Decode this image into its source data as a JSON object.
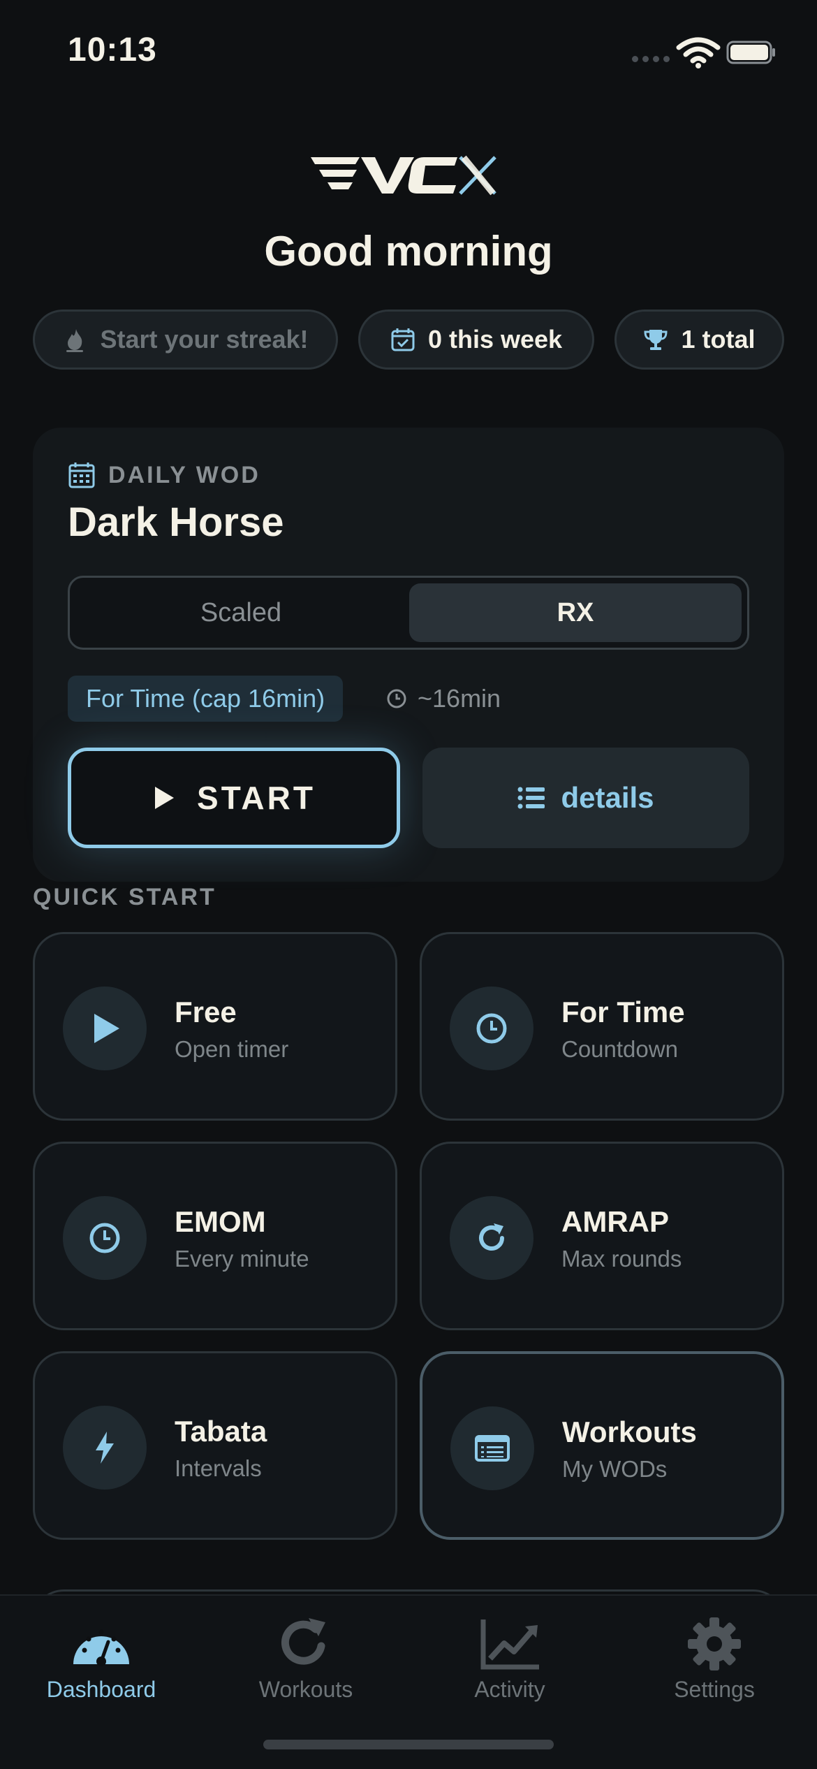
{
  "status_bar": {
    "time": "10:13"
  },
  "header": {
    "greeting": "Good morning"
  },
  "chips": {
    "streak": "Start your streak!",
    "week": "0 this week",
    "total": "1 total"
  },
  "daily_wod": {
    "label": "DAILY WOD",
    "title": "Dark Horse",
    "segment": {
      "options": [
        "Scaled",
        "RX"
      ],
      "selected": "RX"
    },
    "format": "For Time (cap 16min)",
    "duration": "~16min",
    "start_label": "START",
    "details_label": "details"
  },
  "quick_start": {
    "heading": "QUICK START",
    "tiles": [
      {
        "title": "Free",
        "subtitle": "Open timer",
        "icon": "play-icon"
      },
      {
        "title": "For Time",
        "subtitle": "Countdown",
        "icon": "clock-icon"
      },
      {
        "title": "EMOM",
        "subtitle": "Every minute",
        "icon": "clock-icon"
      },
      {
        "title": "AMRAP",
        "subtitle": "Max rounds",
        "icon": "refresh-icon"
      },
      {
        "title": "Tabata",
        "subtitle": "Intervals",
        "icon": "bolt-icon"
      },
      {
        "title": "Workouts",
        "subtitle": "My WODs",
        "icon": "list-card-icon"
      }
    ]
  },
  "tab_bar": {
    "active": "Dashboard",
    "tabs": [
      {
        "label": "Dashboard",
        "icon": "gauge-icon"
      },
      {
        "label": "Workouts",
        "icon": "refresh-icon"
      },
      {
        "label": "Activity",
        "icon": "chart-line-icon"
      },
      {
        "label": "Settings",
        "icon": "gear-icon"
      }
    ]
  },
  "colors": {
    "background": "#0e1012",
    "accent": "#8fcbe9",
    "text": "#f4f1e6",
    "muted": "#8a9094"
  }
}
